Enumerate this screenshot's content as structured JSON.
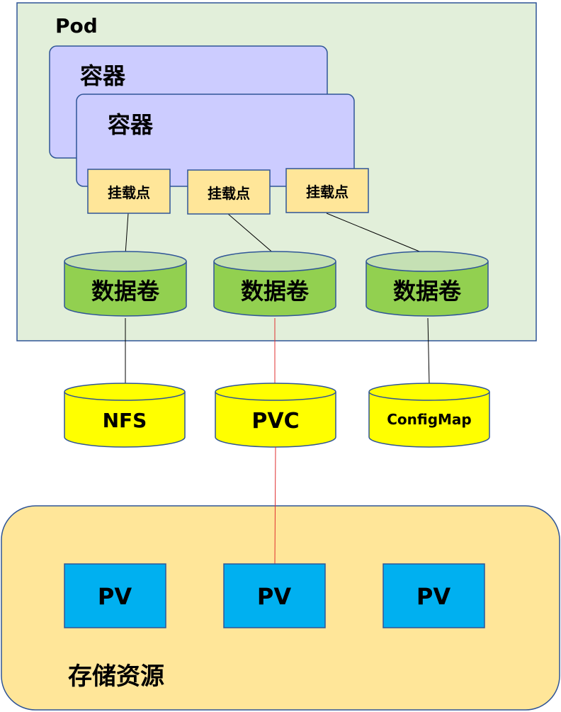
{
  "pod": {
    "title": "Pod",
    "containers": [
      "容器",
      "容器"
    ],
    "mount_points": [
      "挂载点",
      "挂载点",
      "挂载点"
    ],
    "volumes": [
      "数据卷",
      "数据卷",
      "数据卷"
    ]
  },
  "sources": [
    "NFS",
    "PVC",
    "ConfigMap"
  ],
  "storage": {
    "title": "存储资源",
    "pvs": [
      "PV",
      "PV",
      "PV"
    ]
  },
  "colors": {
    "pod_fill": "#E2EFDA",
    "pod_border": "#2F5597",
    "container_fill": "#CCCCFF",
    "container_border": "#2F5597",
    "mount_fill": "#FFE699",
    "mount_border": "#2F5597",
    "volume_fill": "#92D050",
    "volume_top": "#C5E0B4",
    "source_fill": "#FFFF00",
    "storage_fill": "#FFE699",
    "pv_fill": "#00B0F0",
    "link_red": "#E03030"
  }
}
